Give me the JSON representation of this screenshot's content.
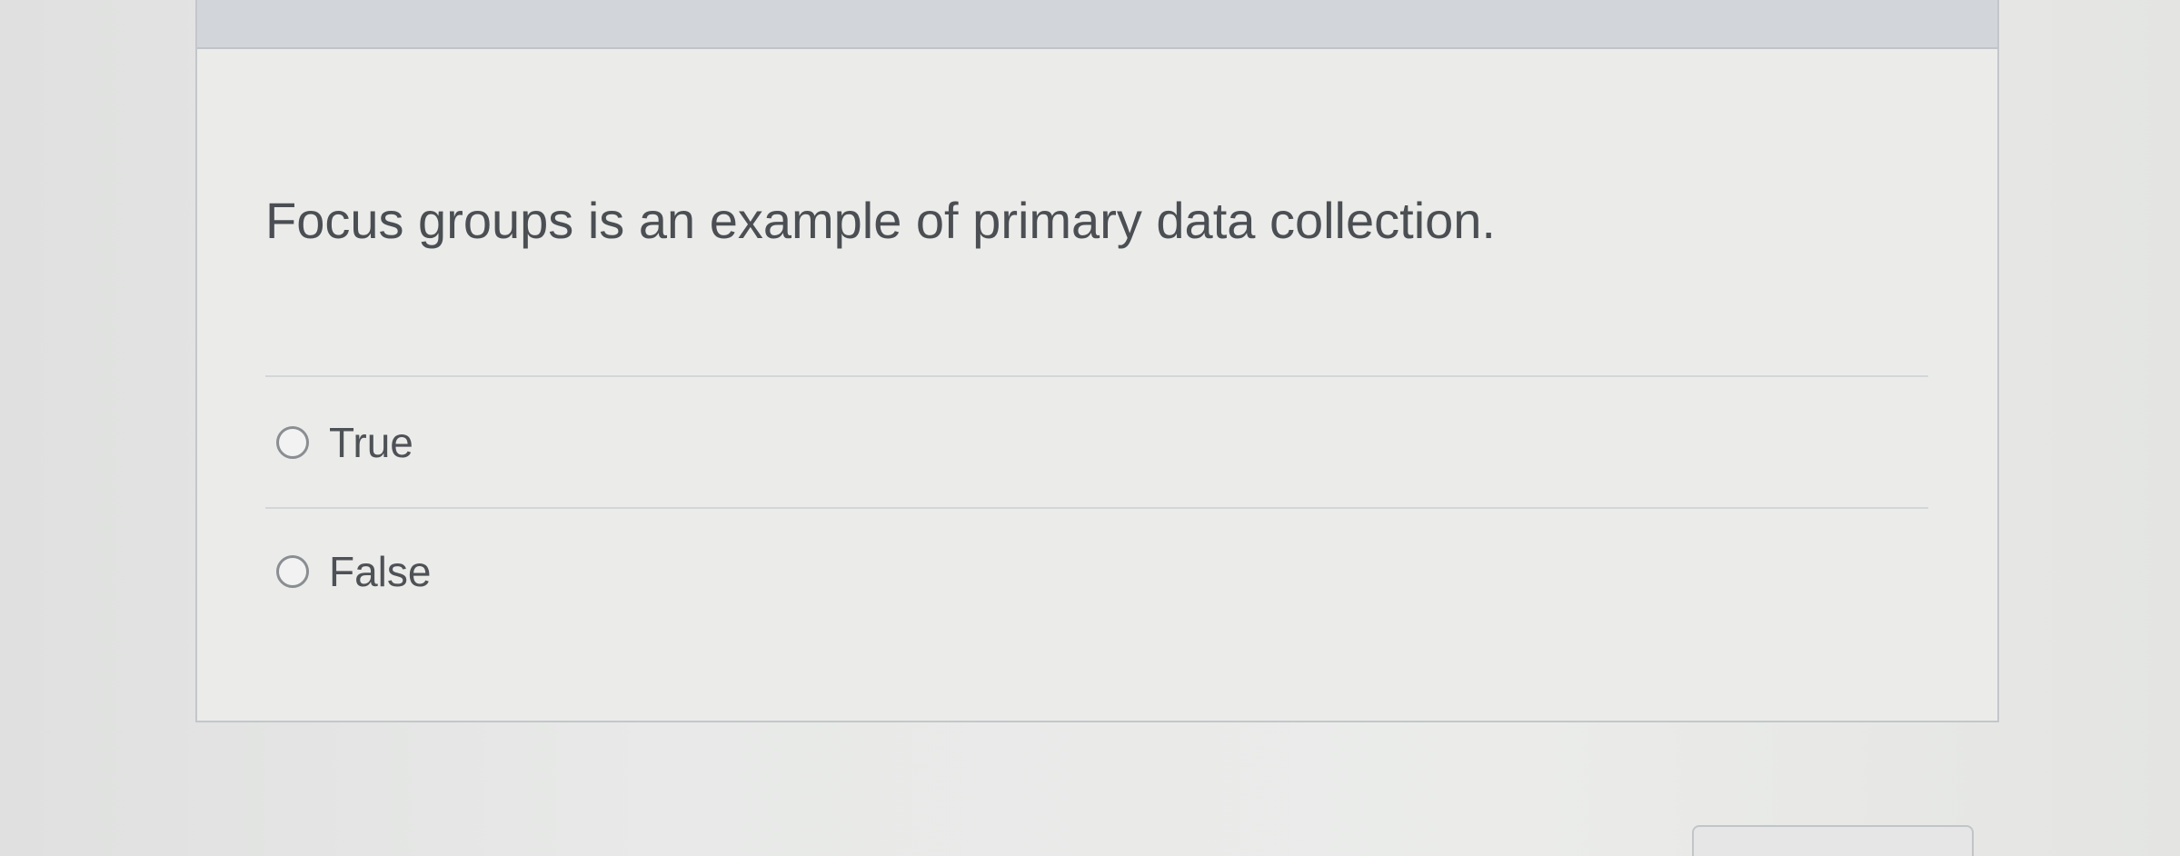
{
  "question": {
    "text": "Focus groups is an example of primary data collection."
  },
  "answers": [
    {
      "label": "True",
      "selected": false
    },
    {
      "label": "False",
      "selected": false
    }
  ],
  "colors": {
    "page_background": "#e6e7e6",
    "card_background": "#ebecea",
    "header_background": "#d2d6da",
    "text": "#4b4f53"
  },
  "icons": {
    "radio": "radio-unchecked-icon"
  }
}
